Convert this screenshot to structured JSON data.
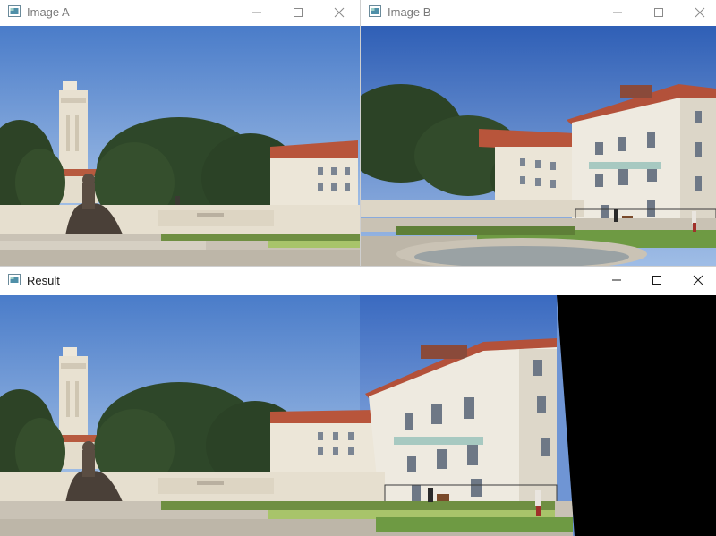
{
  "windows": {
    "image_a": {
      "title": "Image A"
    },
    "image_b": {
      "title": "Image B"
    },
    "result": {
      "title": "Result"
    }
  },
  "controls": {
    "minimize_icon": "minimize-icon",
    "maximize_icon": "maximize-icon",
    "close_icon": "close-icon"
  },
  "colors": {
    "sky_top": "#3f6fc4",
    "sky_bottom": "#b9d0ec",
    "foliage": "#2f4a2a",
    "building": "#e6e0d2",
    "roof": "#b8543a",
    "grass": "#5f8a3a",
    "stitch_black": "#000000"
  }
}
